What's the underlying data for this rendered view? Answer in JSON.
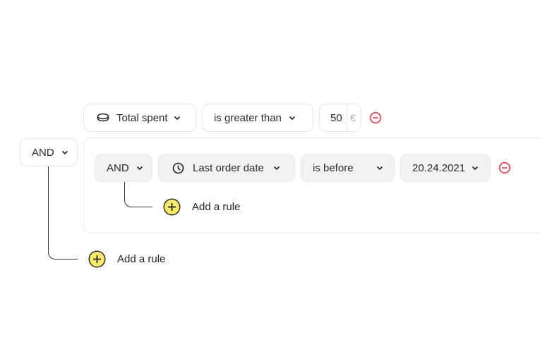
{
  "root_rule": {
    "field": {
      "icon": "coin-icon",
      "label": "Total spent"
    },
    "operator": "is greater than",
    "value": "50",
    "unit": "€",
    "remove_icon": "minus-circle-icon"
  },
  "root_group": {
    "combinator": "AND",
    "add_rule_label": "Add a rule"
  },
  "nested_group": {
    "combinator": "AND",
    "rule": {
      "field": {
        "icon": "clock-icon",
        "label": "Last order date"
      },
      "operator": "is before",
      "value": "20.24.2021",
      "remove_icon": "minus-circle-icon"
    },
    "add_rule_label": "Add a rule"
  },
  "colors": {
    "accent_yellow": "#fbe96a",
    "remove_red": "#e84a5f"
  }
}
